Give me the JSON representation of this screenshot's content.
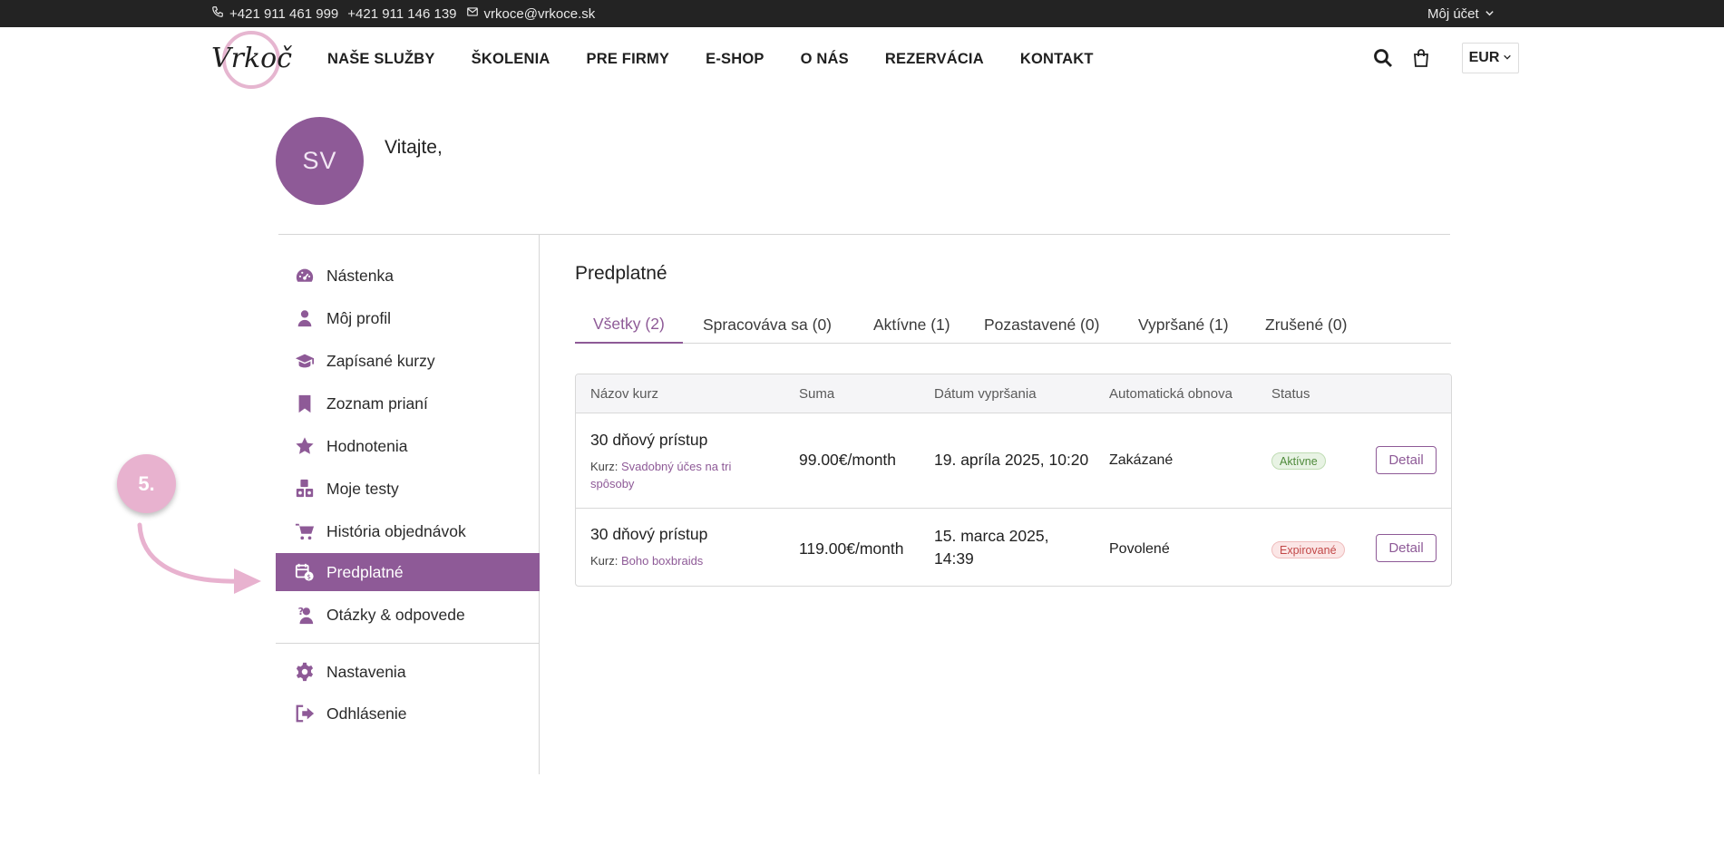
{
  "topbar": {
    "phone1": "+421 911 461 999",
    "phone2": "+421 911 146 139",
    "email": "vrkoce@vrkoce.sk",
    "account_label": "Môj účet"
  },
  "header": {
    "logo_text": "Vrkoče",
    "nav": [
      "NAŠE SLUŽBY",
      "ŠKOLENIA",
      "PRE FIRMY",
      "E-SHOP",
      "O NÁS",
      "REZERVÁCIA",
      "KONTAKT"
    ],
    "currency": "EUR"
  },
  "profile": {
    "initials": "SV",
    "greeting": "Vitajte,"
  },
  "sidebar": {
    "items": [
      {
        "label": "Nástenka",
        "icon": "dashboard-icon"
      },
      {
        "label": "Môj profil",
        "icon": "user-icon"
      },
      {
        "label": "Zapísané kurzy",
        "icon": "graduation-cap-icon"
      },
      {
        "label": "Zoznam prianí",
        "icon": "bookmark-icon"
      },
      {
        "label": "Hodnotenia",
        "icon": "star-icon"
      },
      {
        "label": "Moje testy",
        "icon": "blocks-icon"
      },
      {
        "label": "História objednávok",
        "icon": "cart-icon"
      },
      {
        "label": "Predplatné",
        "icon": "subscription-icon"
      },
      {
        "label": "Otázky & odpovede",
        "icon": "question-user-icon"
      },
      {
        "label": "Nastavenia",
        "icon": "gear-icon"
      },
      {
        "label": "Odhlásenie",
        "icon": "logout-icon"
      }
    ],
    "active_index": 7
  },
  "annotation": {
    "step": "5."
  },
  "main": {
    "title": "Predplatné",
    "tabs": [
      "Všetky (2)",
      "Spracováva sa (0)",
      "Aktívne (1)",
      "Pozastavené (0)",
      "Vypršané (1)",
      "Zrušené (0)"
    ],
    "active_tab": 0,
    "table": {
      "headers": [
        "Názov kurz",
        "Suma",
        "Dátum vypršania",
        "Automatická obnova",
        "Status"
      ],
      "rows": [
        {
          "name": "30 dňový prístup",
          "kurz_prefix": "Kurz:",
          "kurz_link": "Svadobný účes na tri spôsoby",
          "amount": "99.00€/month",
          "expiry": "19. apríla 2025, 10:20",
          "renewal": "Zakázané",
          "status": "Aktívne",
          "action": "Detail"
        },
        {
          "name": "30 dňový prístup",
          "kurz_prefix": "Kurz:",
          "kurz_link": "Boho boxbraids",
          "amount": "119.00€/month",
          "expiry": "15. marca 2025, 14:39",
          "renewal": "Povolené",
          "status": "Expirované",
          "action": "Detail"
        }
      ]
    }
  },
  "colors": {
    "accent": "#8e5a97",
    "topbar": "#232323",
    "annotation": "#e8b2cf",
    "status_active": "#4e8a3a",
    "status_expired": "#c24848"
  }
}
